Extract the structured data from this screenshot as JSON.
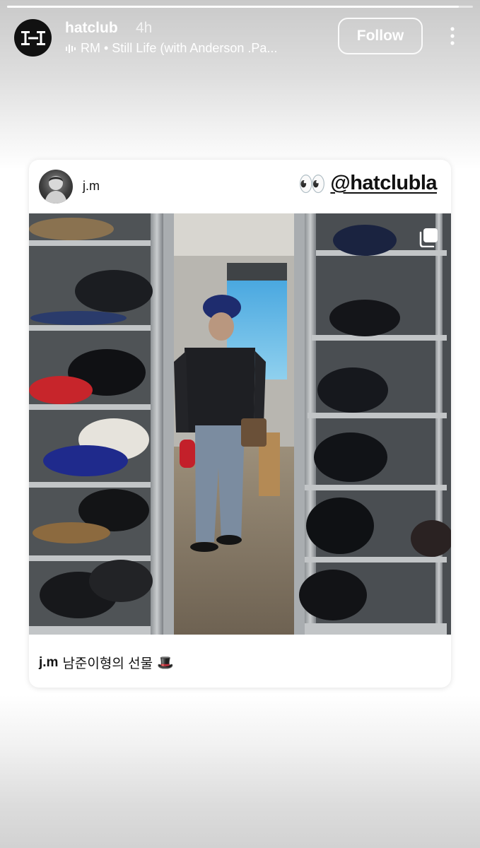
{
  "story": {
    "progress": 0.97,
    "account": {
      "avatar_text": "I-I",
      "username": "hatclub",
      "time": "4h"
    },
    "music": {
      "icon": "music-bars-icon",
      "text": "RM • Still Life (with Anderson .Pa..."
    },
    "follow_label": "Follow",
    "more_icon": "more-vertical-icon"
  },
  "post": {
    "username": "j.m",
    "mention": "@hatclubla",
    "eyes": "👀",
    "photo_icon": "multiple-photos-icon",
    "caption": {
      "username": "j.m",
      "text": "남준이형의 선물",
      "emoji": "🎩"
    }
  }
}
